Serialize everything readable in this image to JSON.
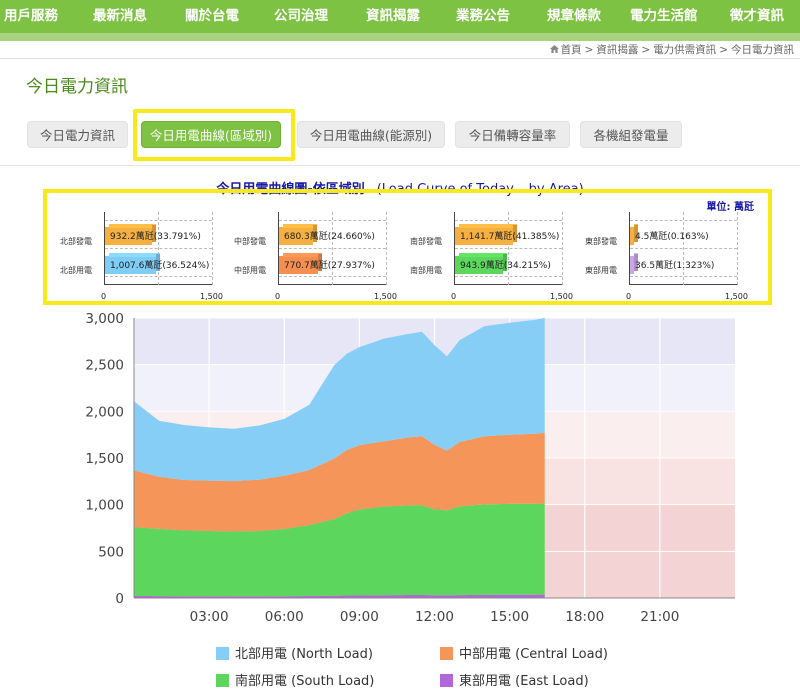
{
  "nav": {
    "items": [
      "用戶服務",
      "最新消息",
      "關於台電",
      "公司治理",
      "資訊揭露",
      "業務公告",
      "規章條款",
      "電力生活館",
      "徵才資訊"
    ],
    "active_index": 4,
    "bg_color": "#7dc242"
  },
  "breadcrumb": {
    "items": [
      "首頁",
      "資訊揭露",
      "電力供需資訊",
      "今日電力資訊"
    ],
    "separator": ">",
    "home_icon": "home-icon"
  },
  "page_title": "今日電力資訊",
  "tabs": {
    "items": [
      "今日電力資訊",
      "今日用電曲線(區域別)",
      "今日用電曲線(能源別)",
      "今日備轉容量率",
      "各機組發電量"
    ],
    "active_index": 1
  },
  "chart_title": {
    "zh": "今日用電曲線圖-依區域別",
    "en": "(Load Curve of Today – by Area)"
  },
  "unit_label": "單位: 萬瓩",
  "regions": [
    {
      "gen_label": "北部發電",
      "load_label": "北部用電",
      "gen_text": "932.2萬瓩(33.791%)",
      "load_text": "1,007.6萬瓩(36.524%)",
      "gen_value": 932.2,
      "load_value": 1007.6,
      "ticks": [
        "0",
        "1,500"
      ],
      "max": 1500
    },
    {
      "gen_label": "中部發電",
      "load_label": "中部用電",
      "gen_text": "680.3萬瓩(24.660%)",
      "load_text": "770.7萬瓩(27.937%)",
      "gen_value": 680.3,
      "load_value": 770.7,
      "ticks": [
        "0",
        "1,500"
      ],
      "max": 1500
    },
    {
      "gen_label": "南部發電",
      "load_label": "南部用電",
      "gen_text": "1,141.7萬瓩(41.385%)",
      "load_text": "943.9萬瓩(34.215%)",
      "gen_value": 1141.7,
      "load_value": 943.9,
      "ticks": [
        "0",
        "1,500"
      ],
      "max": 1500
    },
    {
      "gen_label": "東部發電",
      "load_label": "東部用電",
      "gen_text": "4.5萬瓩(0.163%)",
      "load_text": "36.5萬瓩(1.323%)",
      "gen_value": 4.5,
      "load_value": 36.5,
      "ticks": [
        "0",
        "1,500"
      ],
      "max": 1500
    }
  ],
  "region_colors": {
    "gen": "#f5b041",
    "north_load": "#7fccf5",
    "central_load": "#f58e4f",
    "south_load": "#5cd65c",
    "east_load": "#c9a8e8"
  },
  "chart_data": {
    "type": "area",
    "stacked": true,
    "x_unit": "hour",
    "xlim": [
      0,
      24
    ],
    "ylim": [
      0,
      3000
    ],
    "y_ticks": [
      "0",
      "500",
      "1,000",
      "1,500",
      "2,000",
      "2,500",
      "3,000"
    ],
    "x_ticks": [
      "03:00",
      "06:00",
      "09:00",
      "12:00",
      "15:00",
      "18:00",
      "21:00"
    ],
    "x_tick_values": [
      3,
      6,
      9,
      12,
      15,
      18,
      21
    ],
    "x": [
      0,
      1,
      2,
      3,
      4,
      5,
      6,
      7,
      8,
      8.5,
      9,
      10,
      11,
      11.5,
      12,
      12.5,
      13,
      14,
      15,
      16,
      16.4
    ],
    "series": [
      {
        "name": "東部用電 (East Load)",
        "color": "#b366d9",
        "values": [
          22,
          20,
          19,
          18,
          18,
          18,
          19,
          21,
          25,
          27,
          28,
          30,
          32,
          32,
          30,
          29,
          31,
          33,
          34,
          35,
          36
        ]
      },
      {
        "name": "南部用電 (South Load)",
        "color": "#5cd65c",
        "values": [
          735,
          720,
          705,
          700,
          695,
          700,
          720,
          760,
          820,
          880,
          920,
          950,
          960,
          960,
          920,
          910,
          950,
          970,
          975,
          975,
          975
        ]
      },
      {
        "name": "中部用電 (Central Load)",
        "color": "#f5955a",
        "values": [
          610,
          560,
          540,
          540,
          540,
          550,
          570,
          590,
          650,
          680,
          690,
          700,
          730,
          740,
          690,
          640,
          690,
          730,
          740,
          750,
          760
        ]
      },
      {
        "name": "北部用電 (North Load)",
        "color": "#87cef7",
        "values": [
          740,
          600,
          590,
          570,
          560,
          580,
          610,
          700,
          1000,
          1030,
          1050,
          1100,
          1110,
          1120,
          1070,
          1010,
          1090,
          1180,
          1200,
          1220,
          1230
        ]
      }
    ],
    "bands": [
      {
        "from": 2500,
        "to": 3000,
        "color": "#e6e6f7"
      },
      {
        "from": 2000,
        "to": 2500,
        "color": "#f1f1fb"
      },
      {
        "from": 1500,
        "to": 2000,
        "color": "#fbeeee"
      },
      {
        "from": 1000,
        "to": 1500,
        "color": "#f9e2e2"
      },
      {
        "from": 0,
        "to": 1000,
        "color": "#f3d3d3"
      }
    ],
    "legend": [
      "北部用電 (North Load)",
      "中部用電 (Central Load)",
      "南部用電 (South Load)",
      "東部用電 (East Load)"
    ],
    "legend_colors": [
      "#87cef7",
      "#f5955a",
      "#5cd65c",
      "#b366d9"
    ],
    "legend_position": "bottom",
    "grid": true
  }
}
